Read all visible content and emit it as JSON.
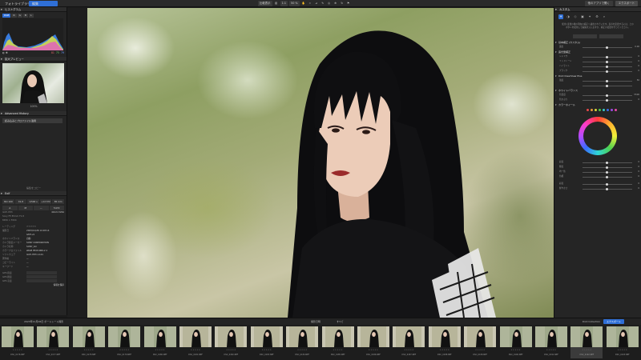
{
  "topbar": {
    "library_tab": "フォトライブラリ",
    "edit_tab": "編集",
    "tools": [
      "比較表示",
      "1:1",
      "50 %"
    ],
    "right_buttons": [
      "他のアプリで開く",
      "エクスポート"
    ]
  },
  "left": {
    "histogram_header": "ヒストグラム",
    "histogram_tabs": [
      "RGB",
      "R",
      "G",
      "B",
      "L"
    ],
    "histogram_readout": {
      "r": "81",
      "g": "75",
      "b": "79"
    },
    "navigator_header": "拡大プレビュー",
    "navigator_label": "100%",
    "history_header": "Advanced History",
    "history_item": "読み込みとプロファイル適用",
    "history_footer": "編集をコピー",
    "exif_header": "Exif",
    "exif_row1": [
      "ISO 100",
      "f/1.8",
      "1/500 s",
      "+0.3 EV",
      "85 mm"
    ],
    "exif_row2": [
      "A",
      "M",
      "—",
      "5472"
    ],
    "camera_model": "ILCE-7M3",
    "camera_extra": "4912×3264",
    "lens": "Sony FE 85mm F1.8",
    "dimensions": "8456 × 5504",
    "meta": [
      {
        "k": "レーティング",
        "v": "☆☆☆☆☆"
      },
      {
        "k": "撮影日",
        "v": "2023/11/26 14:18:14"
      },
      {
        "k": "",
        "v": "GMT+9"
      },
      {
        "k": "ホワイトバランス",
        "v": "自動"
      },
      {
        "k": "カメラ製造メーカー",
        "v": "SONY CORPORATION"
      },
      {
        "k": "カメラ名称",
        "v": "SONY_ILC"
      },
      {
        "k": "カラープロファイル",
        "v": "sRGB IEC61966-2.1"
      },
      {
        "k": "ソフトウェア",
        "v": "ILCE-7M3 v4.01"
      },
      {
        "k": "著作権",
        "v": "—"
      },
      {
        "k": "コピーライト",
        "v": "—"
      },
      {
        "k": "キーワード",
        "v": "—"
      }
    ],
    "gps": [
      "GPS 緯度",
      "GPS 経度",
      "GPS 高度"
    ],
    "panel_footer": "情報を保存"
  },
  "right": {
    "tabs_label": "カスタム",
    "message": "使用 /変更の後の現在の補正へ適用されています。表示を変更するには、上のボタンを使用して編集を元に戻すか、補正の変更を行ってください。",
    "section_basic": "基本補正 (カスタム)",
    "section_light": "露光量補正",
    "section_color": "DxO ClearView Plus",
    "section_tone": "ホワイトバランス",
    "section_hsl": "カラーホイール",
    "rows1": [
      {
        "l": "露出",
        "v": "0.00"
      }
    ],
    "rows2": [
      {
        "l": "シャドウ",
        "v": "0"
      },
      {
        "l": "ミッドトーン",
        "v": "0"
      },
      {
        "l": "ハイライト",
        "v": "0"
      },
      {
        "l": "ブラック",
        "v": "0"
      }
    ],
    "rows3": [
      {
        "l": "強度",
        "v": "50"
      },
      {
        "l": "",
        "v": ""
      }
    ],
    "rows4": [
      {
        "l": "色温度",
        "v": "5500"
      },
      {
        "l": "色かぶり",
        "v": "0"
      }
    ],
    "rows5": [
      {
        "l": "彩度",
        "v": "0"
      },
      {
        "l": "輝度",
        "v": "0"
      },
      {
        "l": "均一性",
        "v": "0"
      },
      {
        "l": "色相",
        "v": "0"
      }
    ],
    "rows6": [
      {
        "l": "彩度",
        "v": "0"
      },
      {
        "l": "鮮やかさ",
        "v": "0"
      }
    ],
    "colors": [
      "#e84a4a",
      "#e89a3a",
      "#d8d83a",
      "#4ac84a",
      "#3ac8c8",
      "#3a6ae8",
      "#a04ae8",
      "#e84aa8"
    ]
  },
  "film": {
    "path": "2023年11月26日 ポートレート撮影",
    "sort_label": "撮影日時",
    "sort2": "すべて",
    "collection": "DxO Collection",
    "export": "エクスポート",
    "thumbs": [
      {
        "name": "DSC_0176.NEF"
      },
      {
        "name": "DSC_0177.NEF"
      },
      {
        "name": "DSC_0178.NEF"
      },
      {
        "name": "DSC_0179.NEF"
      },
      {
        "name": "DSC_0180.NEF"
      },
      {
        "name": "DSC_0181.NEF"
      },
      {
        "name": "DSC_0182.NEF"
      },
      {
        "name": "DSC_0183.NEF"
      },
      {
        "name": "DSC_0184.NEF"
      },
      {
        "name": "DSC_0185.NEF"
      },
      {
        "name": "DSC_0186.NEF"
      },
      {
        "name": "DSC_0187.NEF"
      },
      {
        "name": "DSC_0188.NEF"
      },
      {
        "name": "DSC_0189.NEF"
      },
      {
        "name": "DSC_0190.NEF"
      },
      {
        "name": "DSC_0191.NEF"
      },
      {
        "name": "DSC_0192.NEF"
      },
      {
        "name": "DSC_0193.NEF"
      }
    ]
  }
}
